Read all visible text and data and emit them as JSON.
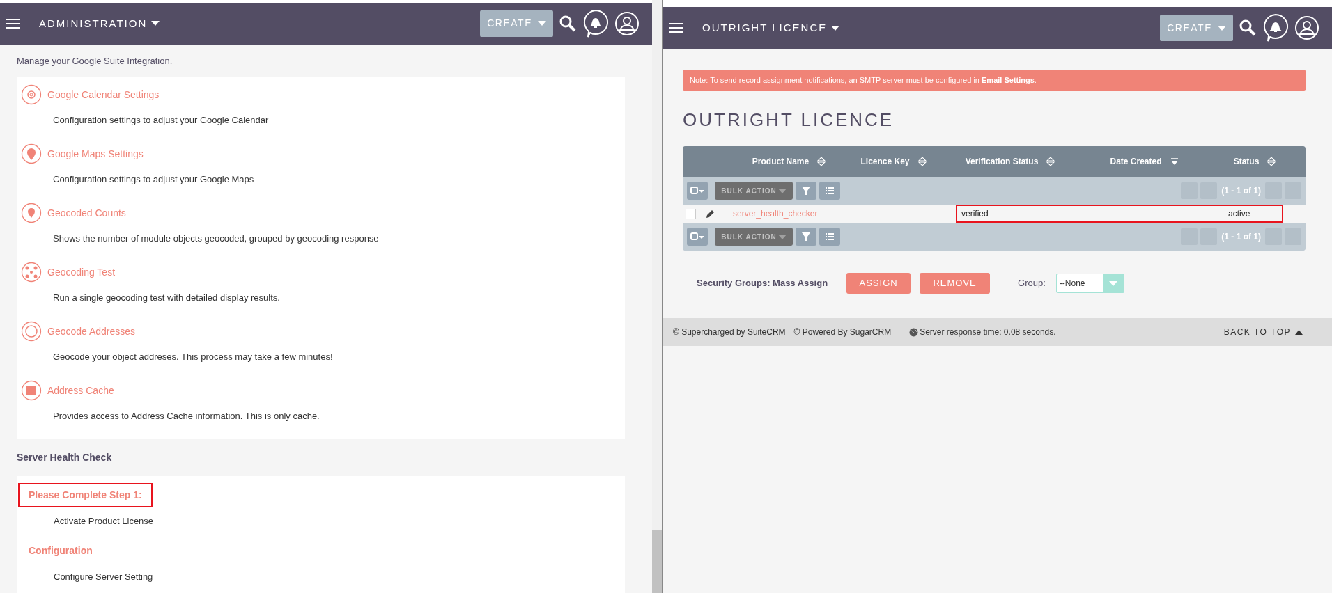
{
  "left": {
    "header": {
      "title": "ADMINISTRATION",
      "create": "CREATE"
    },
    "section_description": "Manage your Google Suite Integration.",
    "google_items": [
      {
        "title": "Google Calendar Settings",
        "description": "Configuration settings to adjust your Google Calendar"
      },
      {
        "title": "Google Maps Settings",
        "description": "Configuration settings to adjust your Google Maps"
      },
      {
        "title": "Geocoded Counts",
        "description": "Shows the number of module objects geocoded, grouped by geocoding response"
      },
      {
        "title": "Geocoding Test",
        "description": "Run a single geocoding test with detailed display results."
      },
      {
        "title": "Geocode Addresses",
        "description": "Geocode your object addreses. This process may take a few minutes!"
      },
      {
        "title": "Address Cache",
        "description": "Provides access to Address Cache information. This is only cache."
      }
    ],
    "health_heading": "Server Health Check",
    "health_items": [
      {
        "title": "Please Complete Step 1:",
        "description": "Activate Product License",
        "highlighted": true
      },
      {
        "title": "Configuration",
        "description": "Configure Server Setting",
        "highlighted": false
      }
    ]
  },
  "right": {
    "header": {
      "title": "OUTRIGHT LICENCE",
      "create": "CREATE"
    },
    "note": "Note: To send record assignment notifications, an SMTP server must be configured in **Email Settings**.",
    "page_title": "OUTRIGHT LICENCE",
    "table": {
      "columns": [
        {
          "label": "Product Name",
          "sorted": false
        },
        {
          "label": "Licence Key",
          "sorted": false
        },
        {
          "label": "Verification Status",
          "sorted": false
        },
        {
          "label": "Date Created",
          "sorted": true
        },
        {
          "label": "Status",
          "sorted": false
        }
      ],
      "toolbars": [
        {
          "bulk_action": "BULK ACTION",
          "pagination": "(1 - 1 of 1)"
        },
        {
          "bulk_action": "BULK ACTION",
          "pagination": "(1 - 1 of 1)"
        }
      ],
      "rows": [
        {
          "checked": false,
          "highlighted": true,
          "cells": [
            "server_health_checker",
            "",
            "verified",
            "",
            "active"
          ]
        }
      ]
    },
    "mass_assign": {
      "label": "Security Groups: Mass Assign",
      "assign": "ASSIGN",
      "remove": "REMOVE",
      "group_label": "Group:",
      "group_value": "--None"
    },
    "footer": {
      "supercharged": "© Supercharged by SuiteCRM",
      "powered": "© Powered By SugarCRM",
      "response": "Server response time: 0.08 seconds.",
      "back_to_top": "BACK TO TOP"
    }
  }
}
